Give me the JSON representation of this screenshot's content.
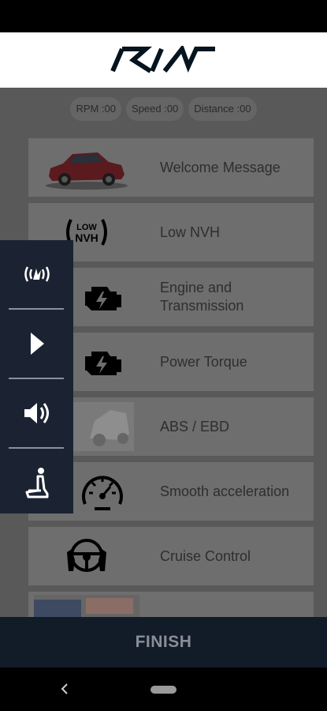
{
  "header": {
    "brand": "KIA"
  },
  "telemetry": {
    "rpm": "RPM :00",
    "speed": "Speed :00",
    "distance": "Distance :00"
  },
  "features": [
    {
      "label": "Welcome Message",
      "icon": "car-photo-icon"
    },
    {
      "label": "Low NVH",
      "icon": "low-nvh-icon"
    },
    {
      "label": "Engine and Transmission",
      "icon": "engine-icon"
    },
    {
      "label": "Power Torque",
      "icon": "engine-icon"
    },
    {
      "label": "ABS / EBD",
      "icon": "abs-photo-icon"
    },
    {
      "label": "Smooth acceleration",
      "icon": "speedometer-icon"
    },
    {
      "label": "Cruise Control",
      "icon": "steering-wheel-icon"
    },
    {
      "label": "",
      "icon": "partial-photo-icon"
    }
  ],
  "side_panel": {
    "items": [
      "vibration-icon",
      "play-icon",
      "volume-icon",
      "seat-icon"
    ]
  },
  "footer": {
    "finish_label": "FINISH"
  },
  "colors": {
    "panel": "#1b2333",
    "finish_bar": "#121b28",
    "overlay": "#595959"
  }
}
